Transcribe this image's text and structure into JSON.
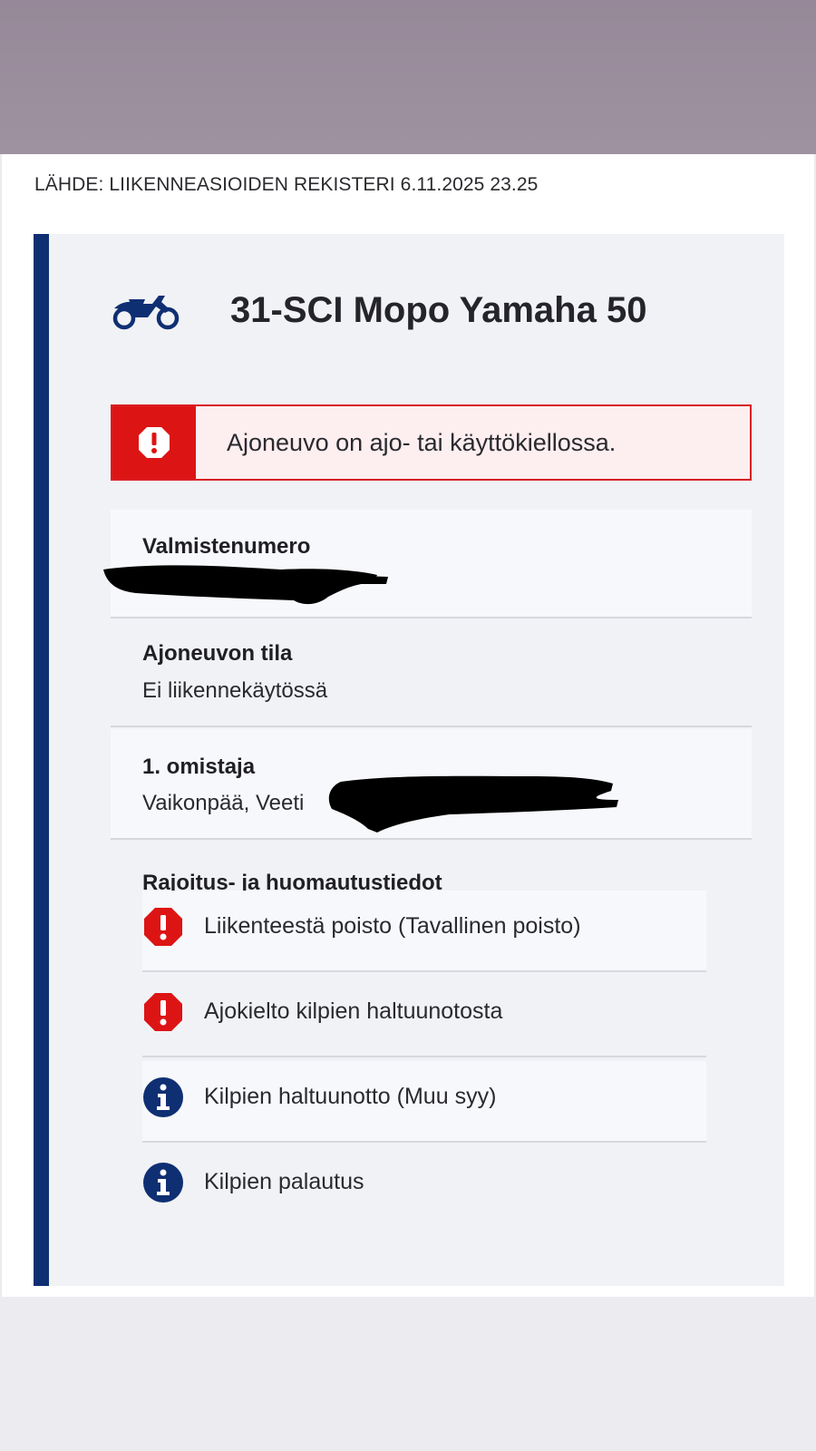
{
  "source": {
    "text": "LÄHDE: LIIKENNEASIOIDEN REKISTERI 6.11.2025 23.25"
  },
  "vehicle": {
    "icon": "motorcycle-icon",
    "title": "31-SCI Mopo Yamaha 50"
  },
  "alert": {
    "icon": "alert-octagon-icon",
    "text": "Ajoneuvo on ajo- tai käyttökiellossa.",
    "color": "#dd1414"
  },
  "fields": {
    "manufacture_number": {
      "label": "Valmistenumero",
      "value_redacted": true
    },
    "vehicle_status": {
      "label": "Ajoneuvon tila",
      "value": "Ei liikennekäytössä"
    },
    "owner": {
      "label": "1. omistaja",
      "value": "Vaikonpää, Veeti",
      "value_partially_redacted": true
    }
  },
  "restrictions": {
    "heading": "Rajoitus- ja huomautustiedot",
    "items": [
      {
        "icon": "error-octagon-icon",
        "label": "Liikenteestä poisto (Tavallinen poisto)",
        "severity": "error"
      },
      {
        "icon": "error-octagon-icon",
        "label": "Ajokielto kilpien haltuunotosta",
        "severity": "error"
      },
      {
        "icon": "info-circle-icon",
        "label": "Kilpien haltuunotto (Muu syy)",
        "severity": "info"
      },
      {
        "icon": "info-circle-icon",
        "label": "Kilpien palautus",
        "severity": "info"
      }
    ]
  },
  "colors": {
    "accent": "#0f2f73",
    "error": "#dd1414",
    "alert_bg": "#fdeef0"
  }
}
